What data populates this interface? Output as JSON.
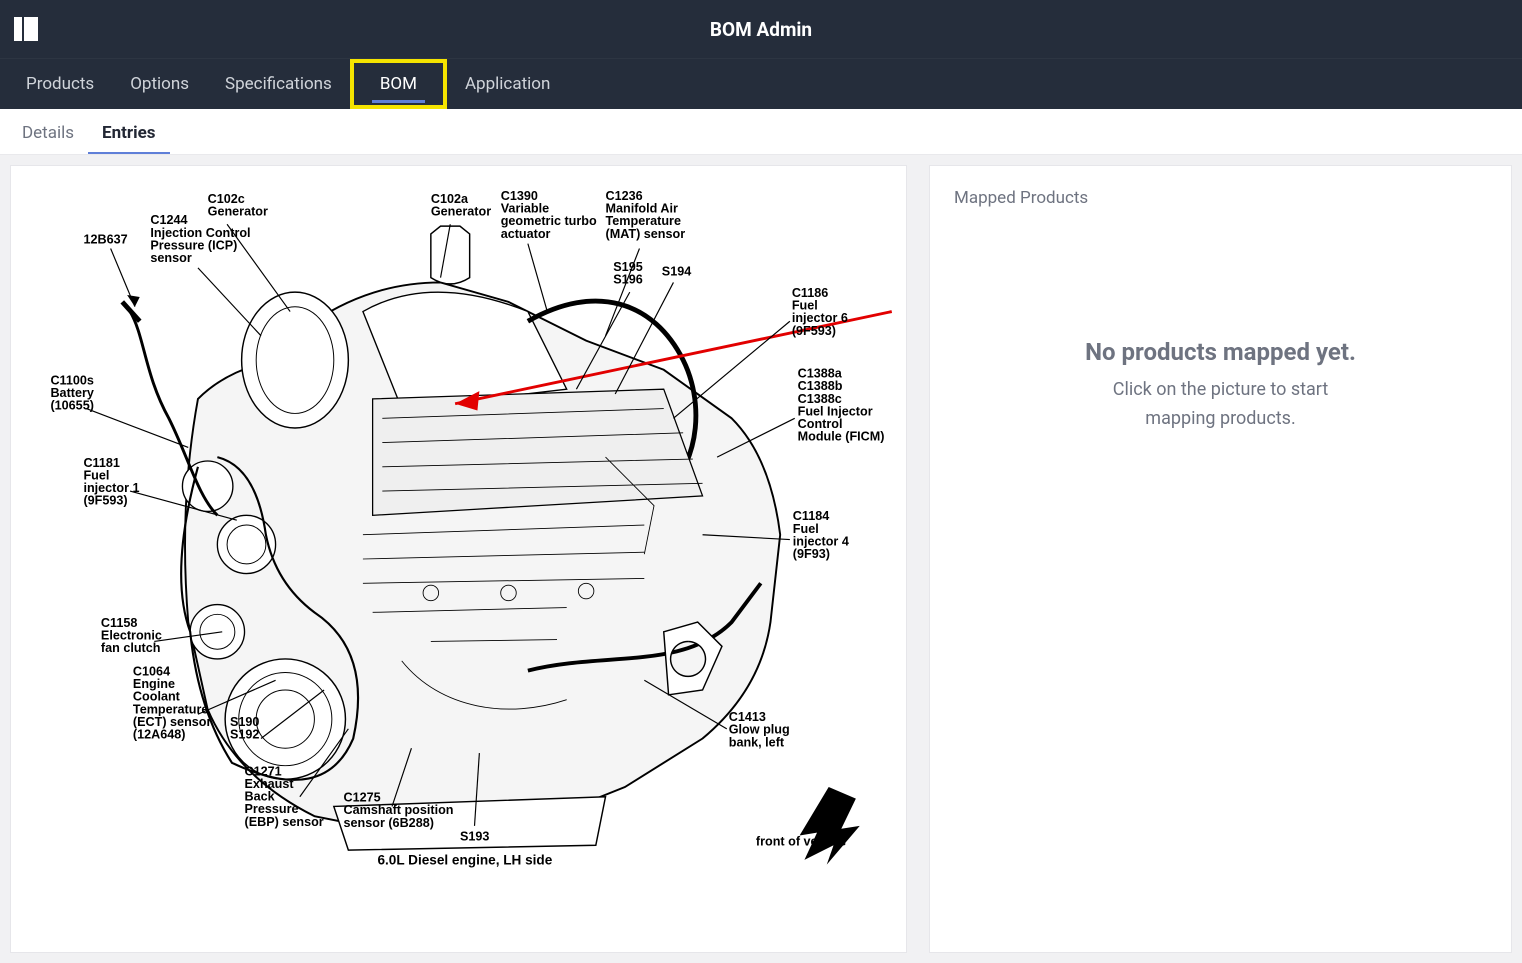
{
  "header": {
    "title": "BOM Admin"
  },
  "nav": {
    "items": [
      {
        "label": "Products"
      },
      {
        "label": "Options"
      },
      {
        "label": "Specifications"
      },
      {
        "label": "BOM",
        "highlighted": true
      },
      {
        "label": "Application"
      }
    ]
  },
  "subnav": {
    "items": [
      {
        "label": "Details"
      },
      {
        "label": "Entries",
        "active": true
      }
    ]
  },
  "diagram": {
    "caption": "6.0L Diesel engine, LH side",
    "front_arrow_label": "front of vehicle",
    "callouts": [
      {
        "id": "c102c",
        "lines": [
          "C102c",
          "Generator"
        ]
      },
      {
        "id": "c102a",
        "lines": [
          "C102a",
          "Generator"
        ]
      },
      {
        "id": "c1390",
        "lines": [
          "C1390",
          "Variable",
          "geometric turbo",
          "actuator"
        ]
      },
      {
        "id": "c1236",
        "lines": [
          "C1236",
          "Manifold Air",
          "Temperature",
          "(MAT) sensor"
        ]
      },
      {
        "id": "c1244",
        "lines": [
          "C1244",
          "Injection Control",
          "Pressure (ICP)",
          "sensor"
        ]
      },
      {
        "id": "12b637",
        "lines": [
          "12B637"
        ]
      },
      {
        "id": "s195_s196",
        "lines": [
          "S195",
          "S196"
        ]
      },
      {
        "id": "s194",
        "lines": [
          "S194"
        ]
      },
      {
        "id": "c1186",
        "lines": [
          "C1186",
          "Fuel",
          "injector 6",
          "(9F593)"
        ]
      },
      {
        "id": "c1388",
        "lines": [
          "C1388a",
          "C1388b",
          "C1388c",
          "Fuel Injector",
          "Control",
          "Module (FICM)"
        ]
      },
      {
        "id": "c1100s",
        "lines": [
          "C1100s",
          "Battery",
          "(10655)"
        ]
      },
      {
        "id": "c1181",
        "lines": [
          "C1181",
          "Fuel",
          "injector 1",
          "(9F593)"
        ]
      },
      {
        "id": "c1184",
        "lines": [
          "C1184",
          "Fuel",
          "injector 4",
          "(9F93)"
        ]
      },
      {
        "id": "c1158",
        "lines": [
          "C1158",
          "Electronic",
          "fan clutch"
        ]
      },
      {
        "id": "c1064",
        "lines": [
          "C1064",
          "Engine",
          "Coolant",
          "Temperature",
          "(ECT) sensor",
          "(12A648)"
        ]
      },
      {
        "id": "s190_s192",
        "lines": [
          "S190",
          "S192"
        ]
      },
      {
        "id": "c1271",
        "lines": [
          "C1271",
          "Exhaust",
          "Back",
          "Pressure",
          "(EBP) sensor"
        ]
      },
      {
        "id": "c1275",
        "lines": [
          "C1275",
          "Camshaft position",
          "sensor (6B288)"
        ]
      },
      {
        "id": "s193",
        "lines": [
          "S193"
        ]
      },
      {
        "id": "c1413",
        "lines": [
          "C1413",
          "Glow plug",
          "bank, left"
        ]
      }
    ]
  },
  "side_panel": {
    "title": "Mapped Products",
    "empty_heading": "No products mapped yet.",
    "empty_sub_line1": "Click on the picture to start",
    "empty_sub_line2": "mapping products."
  }
}
